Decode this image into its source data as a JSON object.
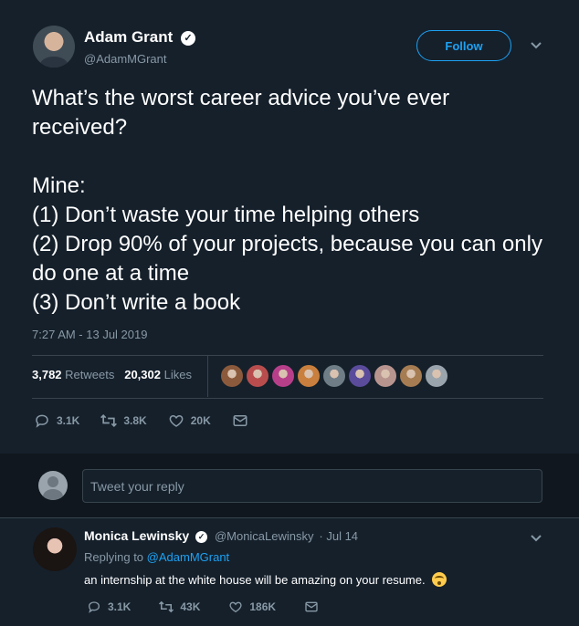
{
  "tweet": {
    "author_name": "Adam Grant",
    "author_handle": "@AdamMGrant",
    "follow_label": "Follow",
    "text": "What’s the worst career advice you’ve ever received?\n\nMine:\n(1) Don’t waste your time helping others\n(2) Drop 90% of your projects, because you can only do one at a time\n(3) Don’t write a book",
    "timestamp": "7:27 AM - 13 Jul 2019",
    "retweets_count": "3,782",
    "retweets_label": "Retweets",
    "likes_count": "20,302",
    "likes_label": "Likes",
    "reply_count": "3.1K",
    "retweet_count_short": "3.8K",
    "like_count_short": "20K"
  },
  "compose": {
    "placeholder": "Tweet your reply"
  },
  "reply": {
    "author_name": "Monica Lewinsky",
    "author_handle": "@MonicaLewinsky",
    "date": "· Jul 14",
    "replying_prefix": "Replying to",
    "replying_to": "@AdamMGrant",
    "text": "an internship at the white house will be amazing on your resume.",
    "reply_count": "3.1K",
    "retweet_count": "43K",
    "like_count": "186K"
  },
  "colors": {
    "background": "#15202b",
    "accent": "#1da1f2",
    "muted": "#8899a6",
    "divider": "#38444d"
  },
  "icons": {
    "verified": "verified-badge-icon",
    "caret": "chevron-down-icon",
    "reply": "reply-icon",
    "retweet": "retweet-icon",
    "like": "heart-icon",
    "dm": "envelope-icon",
    "emoji": "flushed-face-icon"
  },
  "liker_avatar_colors": [
    "#8b5a3c",
    "#b94d4d",
    "#b73f8a",
    "#c97f3d",
    "#6f7d87",
    "#5a4b9b",
    "#b8948f",
    "#a67c52",
    "#9aa4ad"
  ]
}
